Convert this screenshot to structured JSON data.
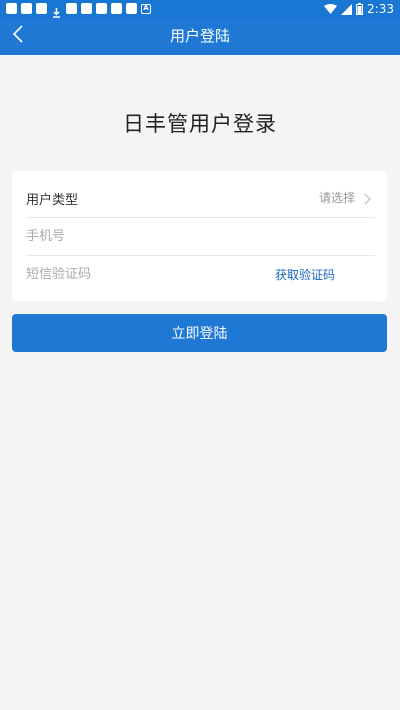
{
  "status_bar": {
    "time": "2:33",
    "icons": [
      "notification-icon",
      "notification-icon",
      "download-icon",
      "notification-icon",
      "notification-icon",
      "notification-icon",
      "notification-icon",
      "notification-icon",
      "notification-icon",
      "accessibility-icon",
      "wifi-icon",
      "signal-icon",
      "battery-icon"
    ]
  },
  "header": {
    "back_icon": "chevron-left-icon",
    "title": "用户登陆"
  },
  "main": {
    "heading": "日丰管用户登录"
  },
  "form": {
    "user_type": {
      "label": "用户类型",
      "value": "请选择",
      "icon": "chevron-right-icon"
    },
    "phone": {
      "placeholder": "手机号"
    },
    "sms_code": {
      "placeholder": "短信验证码",
      "get_code_label": "获取验证码"
    }
  },
  "submit_label": "立即登陆",
  "colors": {
    "primary": "#1e78d4",
    "link": "#1a66c4",
    "background": "#f4f4f4"
  }
}
